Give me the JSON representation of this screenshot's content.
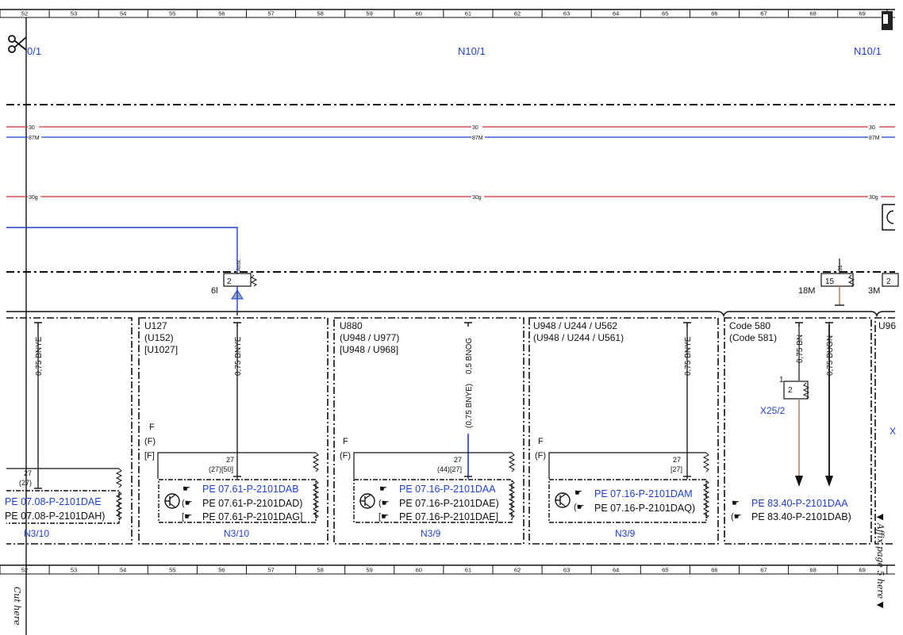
{
  "ruler": {
    "top": [
      "52",
      "53",
      "54",
      "55",
      "56",
      "57",
      "58",
      "59",
      "60",
      "61",
      "62",
      "63",
      "64",
      "65",
      "66",
      "67",
      "68",
      "69"
    ],
    "bottom": [
      "52",
      "53",
      "54",
      "55",
      "56",
      "57",
      "58",
      "59",
      "60",
      "61",
      "62",
      "63",
      "64",
      "65",
      "66",
      "67",
      "68",
      "69"
    ]
  },
  "headers": {
    "n10_left": "0/1",
    "n10_mid": "N10/1",
    "n10_right": "N10/1"
  },
  "lines": {
    "l30_a": "30",
    "l30_b": "30",
    "l30_c": "30",
    "l87_a": "87M",
    "l87_b": "87M",
    "l87_c": "87M",
    "l30g_a": "30g",
    "l30g_b": "30g",
    "l30g_c": "30g"
  },
  "connector_top": {
    "c6l": "6l",
    "c6l_pin": "2",
    "c6l_wire": "Anst.",
    "c18m": "18M",
    "c18m_pin": "15",
    "c18m_wire": "31",
    "c3m": "3M",
    "c3m_pin": "2"
  },
  "panel1": {
    "wire": "0,75 BNYE",
    "pin": "27",
    "pin2": "(27)",
    "ref1": "PE 07.08-P-2101DAE",
    "ref2": "PE 07.08-P-2101DAH)",
    "module": "N3/10"
  },
  "panel2": {
    "code1": "U127",
    "code2": "(U152)",
    "code3": "[U1027]",
    "wire": "0,75 BNYE",
    "f1": "F",
    "f2": "(F)",
    "f3": "[F]",
    "pin": "27",
    "pin2": "(27)[50]",
    "ref1": "PE 07.61-P-2101DAB",
    "ref2": "PE 07.61-P-2101DAD)",
    "ref3": "PE 07.61-P-2101DAG]",
    "module": "N3/10"
  },
  "panel3": {
    "code1": "U880",
    "code2": "(U948 / U977)",
    "code3": "[U948 / U968]",
    "wire": "0,5 BNOG",
    "wire2": "(0,75 BNYE)",
    "f1": "F",
    "f2": "(F)",
    "pin": "27",
    "pin2": "(44)[27]",
    "ref1": "PE 07.16-P-2101DAA",
    "ref2": "PE 07.16-P-2101DAE)",
    "ref3": "PE 07.16-P-2101DAE]",
    "module": "N3/9"
  },
  "panel4": {
    "code1": "U948 / U244 / U562",
    "code2": "(U948 / U244 / U561)",
    "wire": "0,75 BNYE",
    "f1": "F",
    "f2": "(F)",
    "pin": "27",
    "pin2": "[27]",
    "ref1": "PE 07.16-P-2101DAM",
    "ref2": "PE 07.16-P-2101DAQ)",
    "module": "N3/9"
  },
  "panel5": {
    "code1": "Code 580",
    "code2": "(Code 581)",
    "wire1": "0,75 BN",
    "wire2": "0,75 BUGN",
    "pin": "1",
    "pin2": "2",
    "connector": "X25/2",
    "ref1": "PE 83.40-P-2101DAA",
    "ref2": "PE 83.40-P-2101DAB)"
  },
  "panel6": {
    "code1": "U96",
    "conn": "X"
  },
  "margin": {
    "cut_here": "Cut here",
    "affix": "▼ Affix page 5 here ▼"
  },
  "colors": {
    "red": "#e0302a",
    "blue": "#1f3fd0",
    "brown": "#b4876a",
    "black": "#111111"
  },
  "icons": [
    "scissors-icon",
    "page-corner-icon",
    "hand-pointer-icon",
    "transistor-icon"
  ]
}
